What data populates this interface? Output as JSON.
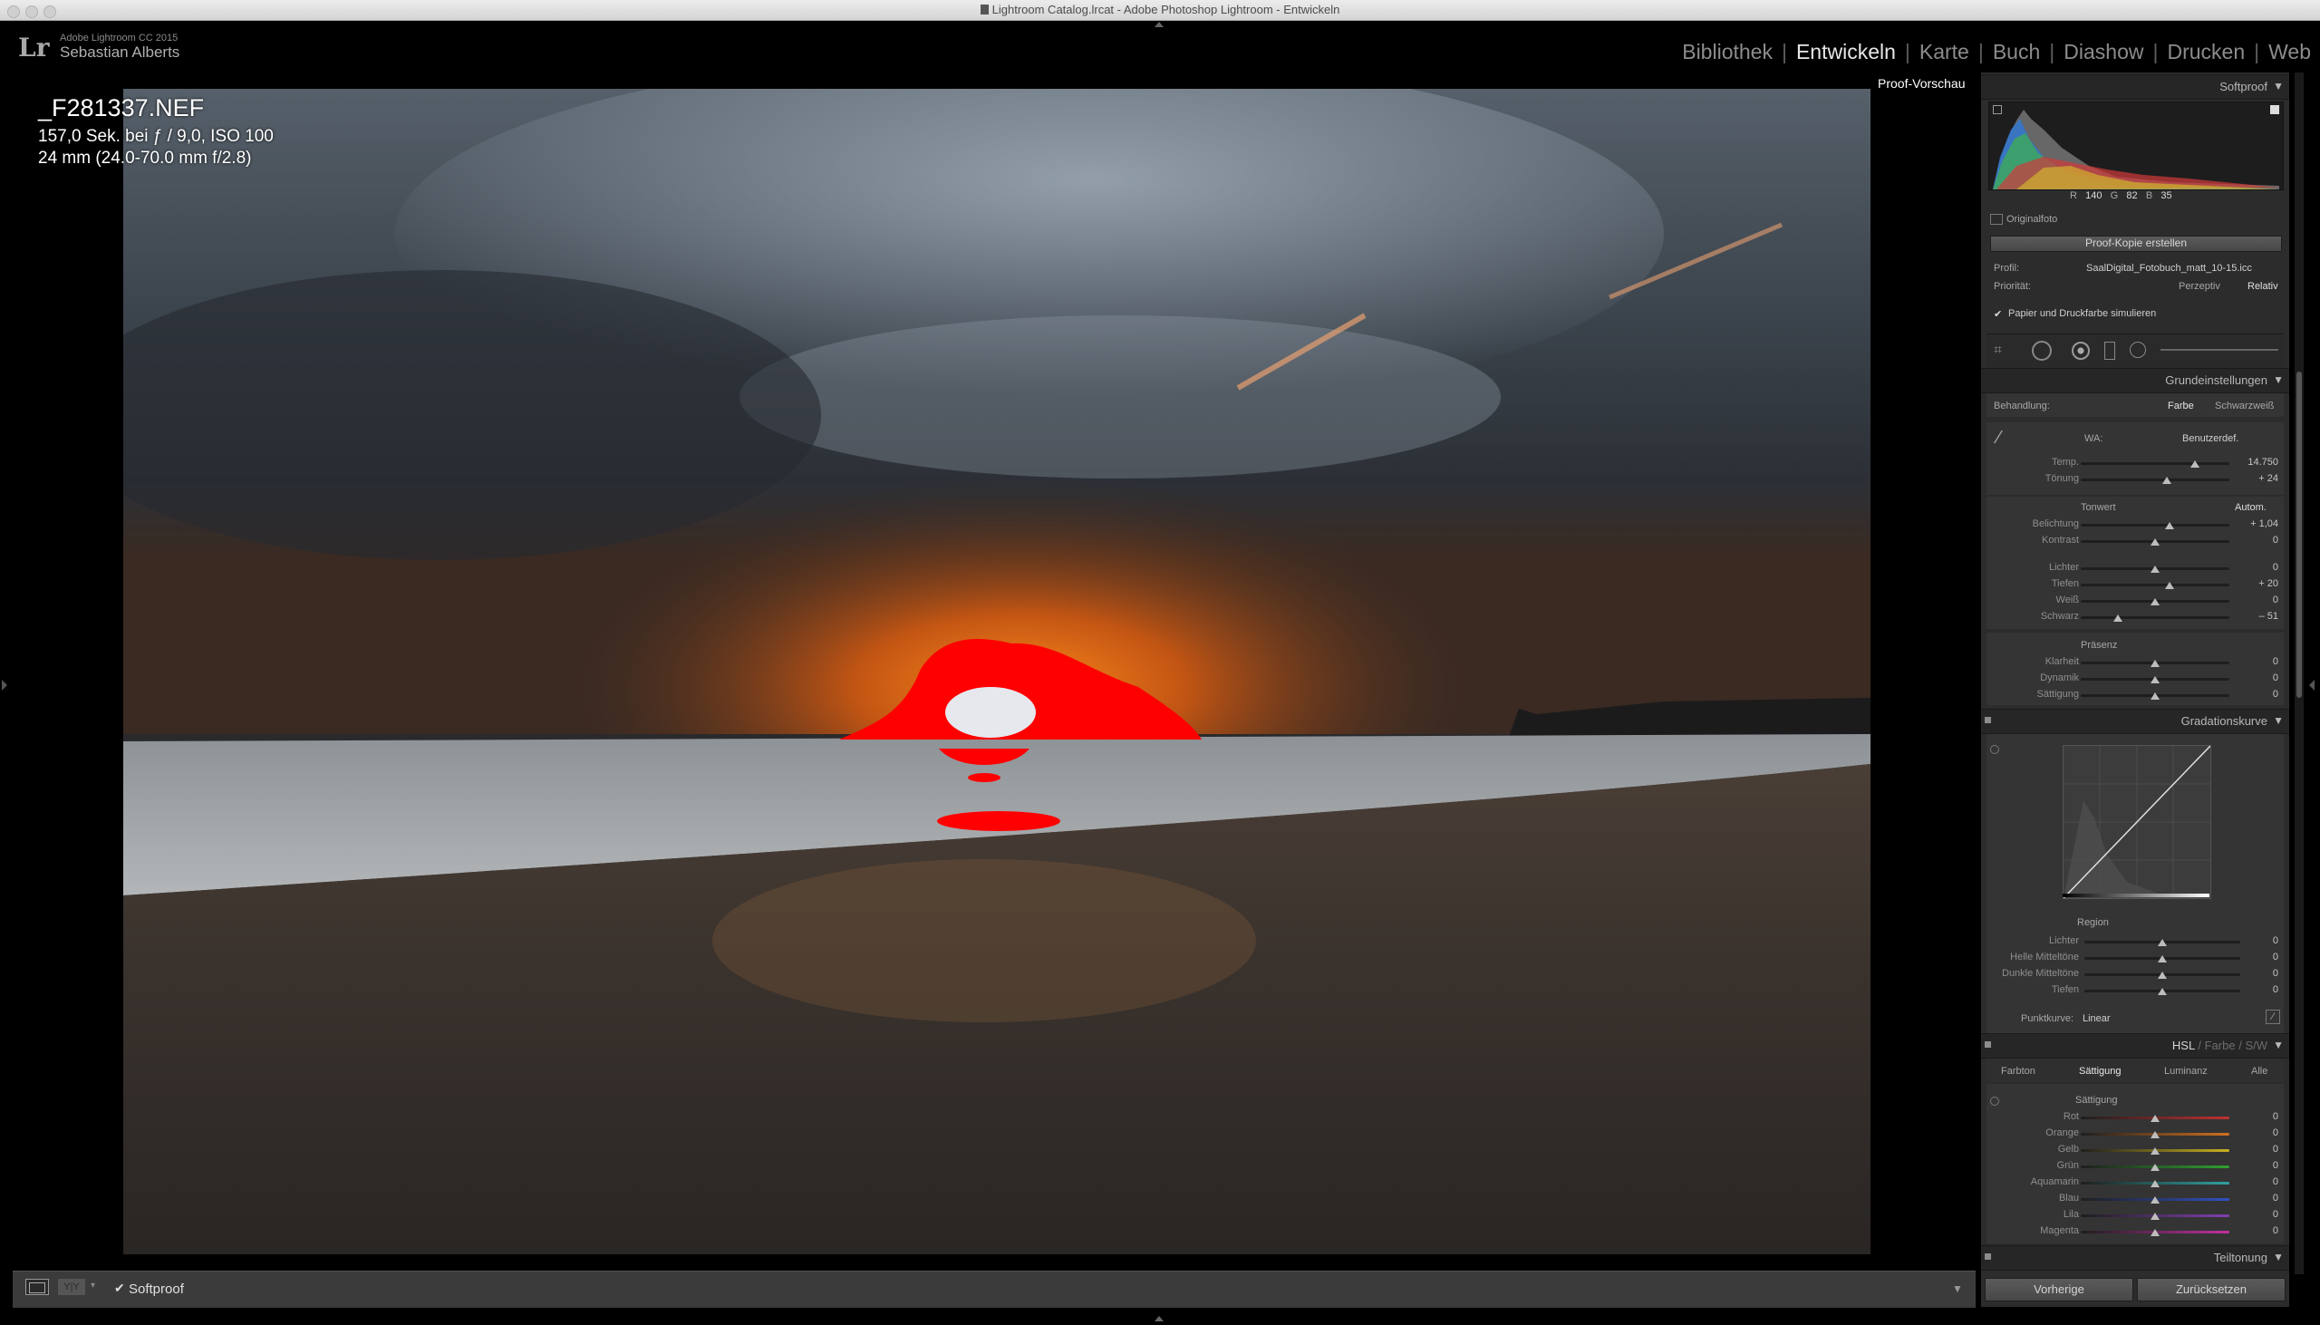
{
  "window": {
    "title": "Lightroom Catalog.lrcat - Adobe Photoshop Lightroom - Entwickeln"
  },
  "identity": {
    "logo": "Lr",
    "app": "Adobe Lightroom CC 2015",
    "user": "Sebastian Alberts"
  },
  "modules": [
    {
      "label": "Bibliothek",
      "active": false
    },
    {
      "label": "Entwickeln",
      "active": true
    },
    {
      "label": "Karte",
      "active": false
    },
    {
      "label": "Buch",
      "active": false
    },
    {
      "label": "Diashow",
      "active": false
    },
    {
      "label": "Drucken",
      "active": false
    },
    {
      "label": "Web",
      "active": false
    }
  ],
  "photo": {
    "filename": "_F281337.NEF",
    "exposure": "157,0 Sek. bei ƒ / 9,0, ISO 100",
    "lens": "24 mm (24.0-70.0 mm f/2.8)",
    "proof_label": "Proof-Vorschau"
  },
  "softproof_panel": {
    "header": "Softproof",
    "rgb": {
      "r_label": "R",
      "r": "140",
      "g_label": "G",
      "g": "82",
      "b_label": "B",
      "b": "35"
    },
    "original_label": "Originalfoto",
    "create_copy": "Proof-Kopie erstellen",
    "profile_label": "Profil:",
    "profile_value": "SaalDigital_Fotobuch_matt_10-15.icc",
    "intent_label": "Priorität:",
    "intent_options": [
      "Perzeptiv",
      "Relativ"
    ],
    "simulate_label": "Papier und Druckfarbe simulieren"
  },
  "basic": {
    "header": "Grundeinstellungen",
    "treatment_label": "Behandlung:",
    "treatment_color": "Farbe",
    "treatment_bw": "Schwarzweiß",
    "wb_label": "WA:",
    "wb_value": "Benutzerdef.",
    "wb_sliders": [
      {
        "label": "Temp.",
        "value": "14.750",
        "pos": 0.77
      },
      {
        "label": "Tönung",
        "value": "+ 24",
        "pos": 0.58
      }
    ],
    "tone_label": "Tonwert",
    "auto_label": "Autom.",
    "tone_sliders": [
      {
        "label": "Belichtung",
        "value": "+ 1,04",
        "pos": 0.6
      },
      {
        "label": "Kontrast",
        "value": "0",
        "pos": 0.5
      }
    ],
    "tone_sliders2": [
      {
        "label": "Lichter",
        "value": "0",
        "pos": 0.5
      },
      {
        "label": "Tiefen",
        "value": "+ 20",
        "pos": 0.6
      },
      {
        "label": "Weiß",
        "value": "0",
        "pos": 0.5
      },
      {
        "label": "Schwarz",
        "value": "– 51",
        "pos": 0.25
      }
    ],
    "presence_label": "Präsenz",
    "presence_sliders": [
      {
        "label": "Klarheit",
        "value": "0",
        "pos": 0.5
      },
      {
        "label": "Dynamik",
        "value": "0",
        "pos": 0.5
      },
      {
        "label": "Sättigung",
        "value": "0",
        "pos": 0.5
      }
    ]
  },
  "curve": {
    "header": "Gradationskurve",
    "region_label": "Region",
    "sliders": [
      {
        "label": "Lichter",
        "value": "0",
        "pos": 0.5
      },
      {
        "label": "Helle Mitteltöne",
        "value": "0",
        "pos": 0.5
      },
      {
        "label": "Dunkle Mitteltöne",
        "value": "0",
        "pos": 0.5
      },
      {
        "label": "Tiefen",
        "value": "0",
        "pos": 0.5
      }
    ],
    "point_curve_label": "Punktkurve:",
    "point_curve_value": "Linear"
  },
  "hsl": {
    "header_items": [
      "HSL",
      "/",
      "Farbe",
      "/",
      "S/W"
    ],
    "tabs": [
      "Farbton",
      "Sättigung",
      "Luminanz",
      "Alle"
    ],
    "active_tab": 1,
    "group_label": "Sättigung",
    "sliders": [
      {
        "label": "Rot",
        "value": "0",
        "color": "#c03030"
      },
      {
        "label": "Orange",
        "value": "0",
        "color": "#d07020"
      },
      {
        "label": "Gelb",
        "value": "0",
        "color": "#c8b020"
      },
      {
        "label": "Grün",
        "value": "0",
        "color": "#30a030"
      },
      {
        "label": "Aquamarin",
        "value": "0",
        "color": "#30a0a0"
      },
      {
        "label": "Blau",
        "value": "0",
        "color": "#3050c0"
      },
      {
        "label": "Lila",
        "value": "0",
        "color": "#8040b0"
      },
      {
        "label": "Magenta",
        "value": "0",
        "color": "#c030a0"
      }
    ]
  },
  "split": {
    "header": "Teiltonung"
  },
  "bottom": {
    "prev": "Vorherige",
    "reset": "Zurücksetzen"
  },
  "toolbar": {
    "softproof_label": "Softproof",
    "view_icon": "loupe-view-icon",
    "compare_icon": "before-after-icon"
  }
}
